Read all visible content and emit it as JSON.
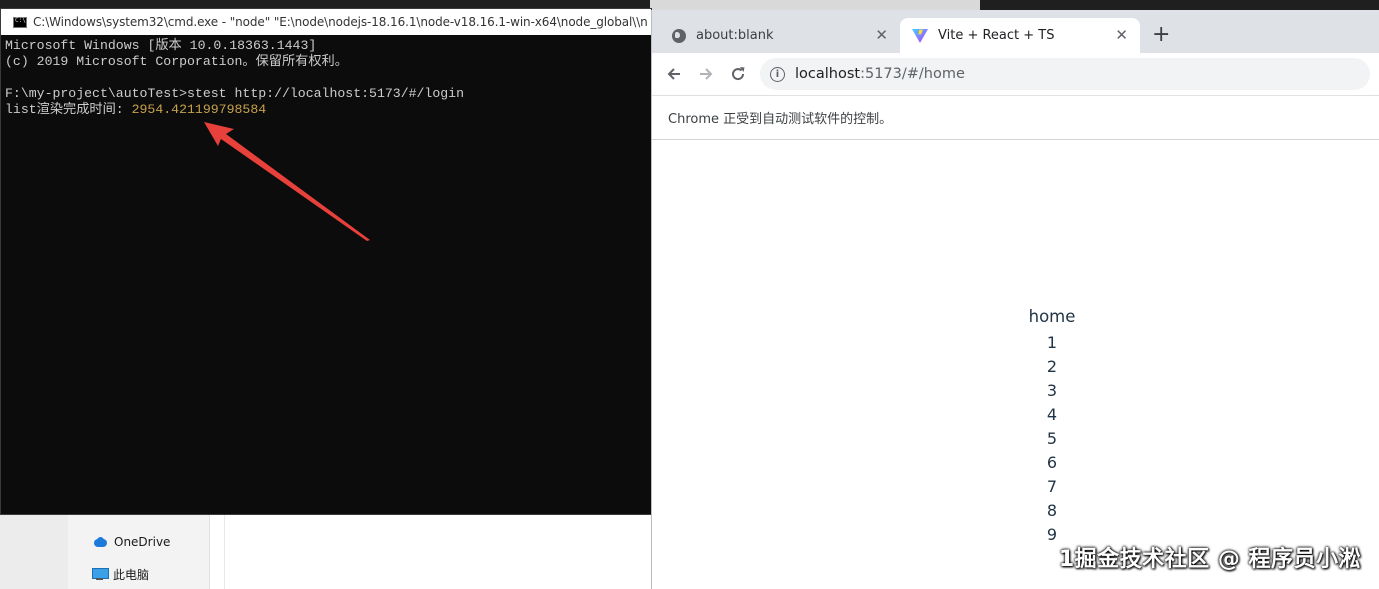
{
  "explorer": {
    "nav_items": [
      {
        "label": "OneDrive",
        "icon": "cloud-icon"
      },
      {
        "label": "此电脑",
        "icon": "computer-icon"
      }
    ]
  },
  "cmd": {
    "title": "C:\\Windows\\system32\\cmd.exe  - \"node\"   \"E:\\node\\nodejs-18.16.1\\node-v18.16.1-win-x64\\node_global\\\\n",
    "lines": [
      "Microsoft Windows [版本 10.0.18363.1443]",
      "(c) 2019 Microsoft Corporation。保留所有权利。",
      "",
      "F:\\my-project\\autoTest>stest http://localhost:5173/#/login"
    ],
    "render_label": "list渲染完成时间: ",
    "render_value": "2954.421199798584",
    "value_color": "#c7a14a"
  },
  "chrome": {
    "tabs": [
      {
        "label": "about:blank",
        "icon": "globe-icon",
        "active": false
      },
      {
        "label": "Vite + React + TS",
        "icon": "vite-icon",
        "active": true
      }
    ],
    "new_tab_label": "+",
    "url_host": "localhost",
    "url_path": ":5173/#/home",
    "infobar_text": "Chrome 正受到自动测试软件的控制。"
  },
  "page": {
    "heading": "home",
    "items": [
      "1",
      "2",
      "3",
      "4",
      "5",
      "6",
      "7",
      "8",
      "9"
    ]
  },
  "watermark": "1掘金技术社区 @ 程序员小淞",
  "colors": {
    "arrow": "#e8403a",
    "terminal_bg": "#0c0c0c",
    "tabstrip_bg": "#dee1e6"
  }
}
